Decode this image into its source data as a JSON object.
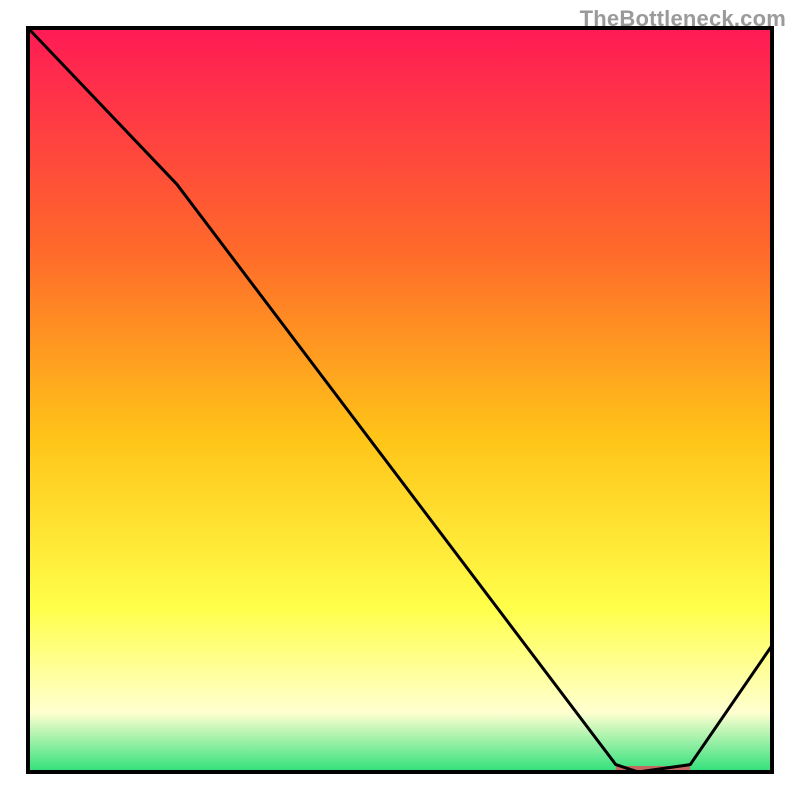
{
  "watermark": "TheBottleneck.com",
  "colors": {
    "gradient_top": "#ff1a55",
    "gradient_mid1": "#ff6a2a",
    "gradient_mid2": "#ffc418",
    "gradient_mid3": "#ffff4a",
    "gradient_mid4": "#ffffd0",
    "gradient_bottom": "#2fe07a",
    "line": "#000000",
    "bottom_marker": "#c46a63",
    "frame": "#000000"
  },
  "chart_data": {
    "type": "line",
    "title": "",
    "xlabel": "",
    "ylabel": "",
    "xlim": [
      0,
      100
    ],
    "ylim": [
      0,
      100
    ],
    "x": [
      0,
      20,
      79,
      82,
      89,
      100
    ],
    "values": [
      100,
      79,
      1,
      0,
      1,
      17
    ],
    "marker": {
      "x_start": 79,
      "x_end": 89,
      "y": 0
    },
    "notes": "Values are percentages of plot height; chart has no numeric axis labels in source image."
  }
}
